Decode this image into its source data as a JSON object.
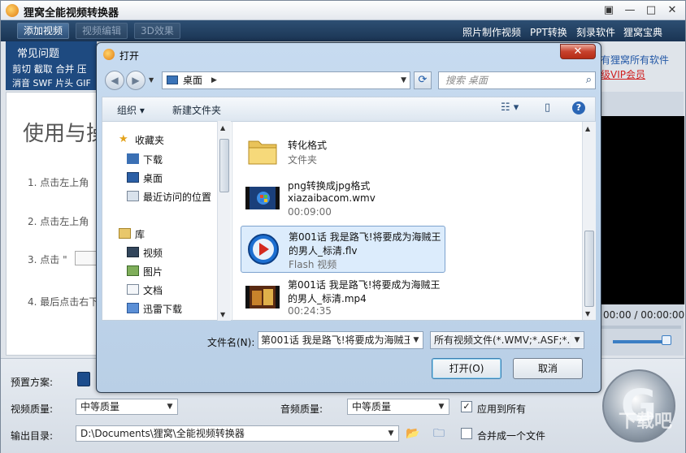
{
  "app": {
    "title": "狸窝全能视频转换器",
    "window_buttons": [
      "▣",
      "—",
      "□",
      "✕"
    ],
    "toolbar": {
      "add_video": "添加视频",
      "edit_video": "视频编辑",
      "effect_3d": "3D效果",
      "links": [
        "照片制作视频",
        "PPT转换",
        "刻录软件",
        "狸窝宝典"
      ]
    },
    "left_panel": {
      "faq": "常见问题",
      "tags_line1": "剪切 截取 合并 压",
      "tags_line2": "消音 SWF 片头 GIF"
    },
    "guide": {
      "heading": "使用与操",
      "steps": [
        "1. 点击左上角",
        "2. 点击左上角",
        "3. 点击 \"",
        "4. 最后点击右下"
      ]
    },
    "right_banner": {
      "line1": "有狸窝所有软件",
      "line2": "级VIP会员"
    },
    "preview": {
      "time": "00:00 / 00:00:00"
    },
    "settings": {
      "preset_label": "预置方案:",
      "video_quality_label": "视频质量:",
      "video_quality_value": "中等质量",
      "audio_quality_label": "音频质量:",
      "audio_quality_value": "中等质量",
      "apply_all_label": "应用到所有",
      "apply_all_checked": true,
      "output_dir_label": "输出目录:",
      "output_dir_value": "D:\\Documents\\狸窝\\全能视频转换器",
      "merge_label": "合并成一个文件",
      "merge_checked": false
    },
    "watermark": "下载吧"
  },
  "dialog": {
    "title": "打开",
    "close": "✕",
    "address": "桌面",
    "search_placeholder": "搜索 桌面",
    "organize": "组织 ▾",
    "new_folder": "新建文件夹",
    "nav": [
      {
        "label": "收藏夹",
        "icon": "star-icon"
      },
      {
        "label": "下载",
        "icon": "downloads-icon"
      },
      {
        "label": "桌面",
        "icon": "desktop-icon"
      },
      {
        "label": "最近访问的位置",
        "icon": "recent-places-icon"
      },
      {
        "label": "库",
        "icon": "library-icon"
      },
      {
        "label": "视频",
        "icon": "videos-icon"
      },
      {
        "label": "图片",
        "icon": "pictures-icon"
      },
      {
        "label": "文档",
        "icon": "documents-icon"
      },
      {
        "label": "迅雷下载",
        "icon": "thunder-download-icon"
      }
    ],
    "files": [
      {
        "name1": "转化格式",
        "name2": "",
        "meta": "文件夹",
        "icon": "folder-icon",
        "selected": false
      },
      {
        "name1": "png转换成jpg格式",
        "name2": "xiazaibacom.wmv",
        "meta": "00:09:00",
        "icon": "wmv-video-thumbnail",
        "selected": false
      },
      {
        "name1": "第001话 我是路飞!将要成为海贼王",
        "name2": "的男人_标清.flv",
        "meta": "Flash 视频",
        "icon": "flash-video-icon",
        "selected": true
      },
      {
        "name1": "第001话 我是路飞!将要成为海贼王",
        "name2": "的男人_标清.mp4",
        "meta": "00:24:35",
        "icon": "mp4-video-thumbnail",
        "selected": false
      }
    ],
    "filename_label": "文件名(N):",
    "filename_value": "第001话 我是路飞!将要成为海贼王",
    "filetype_value": "所有视频文件(*.WMV;*.ASF;*.W",
    "open_button": "打开(O)",
    "cancel_button": "取消"
  }
}
